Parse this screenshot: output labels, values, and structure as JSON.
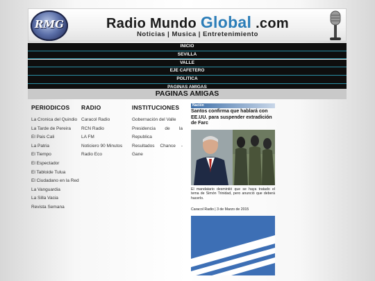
{
  "header": {
    "logo_text": "RMG",
    "title_prefix": "Radio Mundo ",
    "title_highlight": "Global",
    "title_suffix": " .com",
    "tagline": "Noticias | Musica | Entretenimiento"
  },
  "nav": {
    "items": [
      "INICIO",
      "SEVILLA",
      "VALLE",
      "EJE CAFETERO",
      "POLITICA",
      "PAGINAS AMIGAS"
    ]
  },
  "section_title": "PAGINAS AMIGAS",
  "columns": {
    "periodicos": {
      "heading": "PERIODICOS",
      "links": [
        "La Cronica del Quindio",
        "La Tarde de Pereira",
        "El Pais Cali",
        "La Patria",
        "El Tiempo",
        "El Espectador",
        "El Tabloide Tulua",
        "El Ciudadano en la Red",
        "La Vanguardia",
        "La Silla Vacia",
        "Revista Semana"
      ]
    },
    "radio": {
      "heading": "RADIO",
      "links": [
        "Caracol Radio",
        "RCN Radio",
        "LA FM",
        "Noticiero 90 Minutos",
        "Radio Eco"
      ]
    },
    "instituciones": {
      "heading": "INSTITUCIONES",
      "links": [
        "Gobernación del Valle",
        "Presidencia de la Republica",
        "Resultados Chance - Gane"
      ]
    }
  },
  "news": {
    "tag": "Nación",
    "headline": "Santos confirma que hablará con EE.UU. para suspender extradición de Farc",
    "summary": "El mandatario desmintió que se haya tratado el tema de Simón Trinidad, pero anunció que deberá hacerlo.",
    "source": "Caracol Radio | 3 de Marzo de 2015"
  },
  "colors": {
    "nav_bg": "#0e0e0e",
    "nav_border": "#2a8fa5",
    "accent_blue": "#2b7db8",
    "section_bg": "#c9c9c9"
  }
}
